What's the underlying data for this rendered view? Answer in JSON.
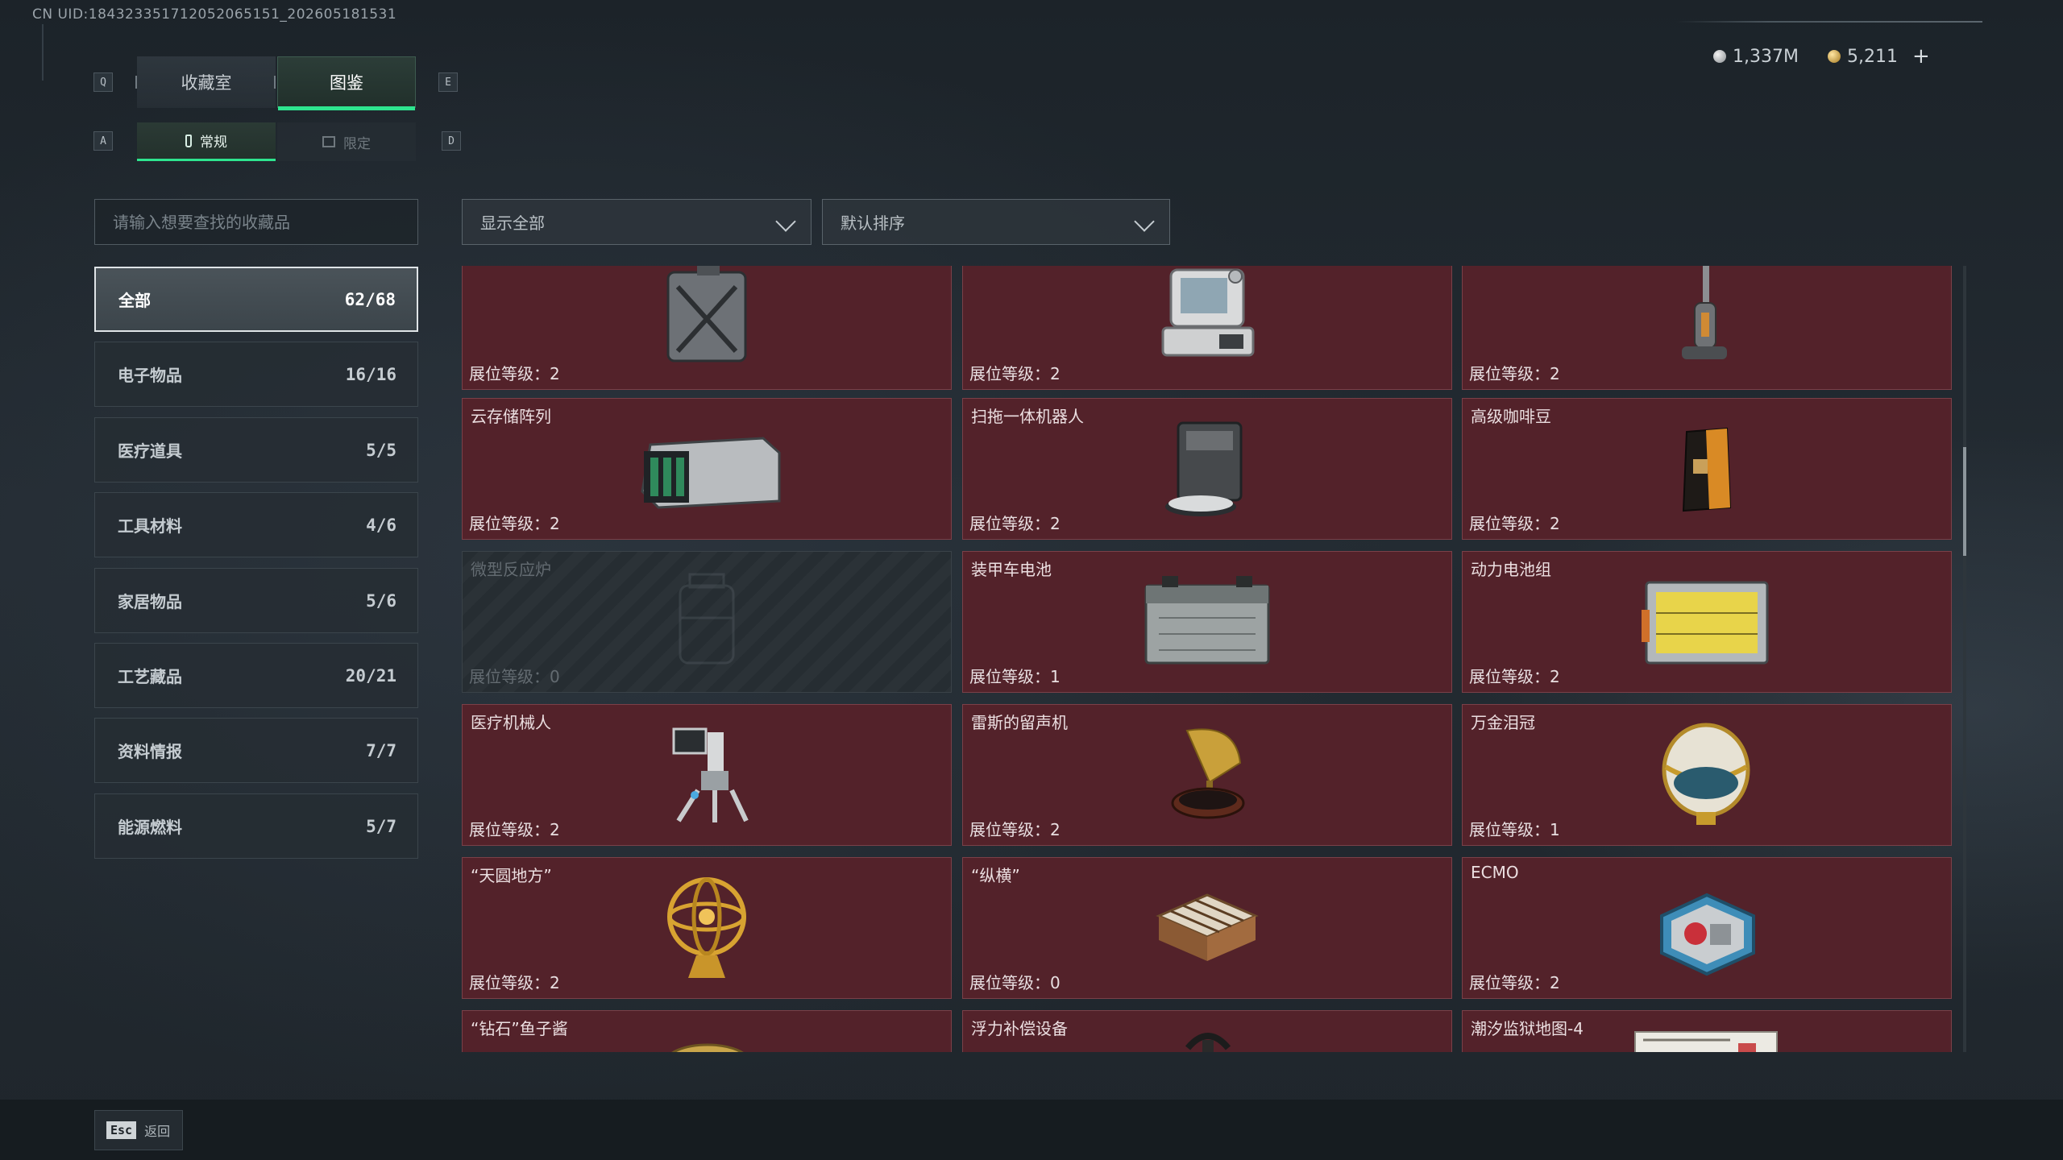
{
  "uid_text": "CN UID:184323351712052065151_202605181531",
  "top_tabs": {
    "left_key": "Q",
    "right_key": "E",
    "items": [
      {
        "label": "收藏室",
        "active": false
      },
      {
        "label": "图鉴",
        "active": true
      }
    ]
  },
  "sub_tabs": {
    "left_key": "A",
    "right_key": "D",
    "items": [
      {
        "label": "常规",
        "icon": "bottle-icon",
        "active": true
      },
      {
        "label": "限定",
        "icon": "image-icon",
        "active": false
      }
    ]
  },
  "currency": {
    "silver": {
      "value": "1,337M",
      "icon": "silver-coin-icon"
    },
    "gold": {
      "value": "5,211",
      "icon": "gold-coin-icon",
      "add_label": "+"
    }
  },
  "search": {
    "placeholder": "请输入想要查找的收藏品",
    "value": ""
  },
  "filters": {
    "display": "显示全部",
    "sort": "默认排序"
  },
  "categories": [
    {
      "label": "全部",
      "count": "62/68",
      "active": true
    },
    {
      "label": "电子物品",
      "count": "16/16",
      "active": false
    },
    {
      "label": "医疗道具",
      "count": "5/5",
      "active": false
    },
    {
      "label": "工具材料",
      "count": "4/6",
      "active": false
    },
    {
      "label": "家居物品",
      "count": "5/6",
      "active": false
    },
    {
      "label": "工艺藏品",
      "count": "20/21",
      "active": false
    },
    {
      "label": "资料情报",
      "count": "7/7",
      "active": false
    },
    {
      "label": "能源燃料",
      "count": "5/7",
      "active": false
    }
  ],
  "level_prefix": "展位等级：",
  "items": [
    {
      "name": "",
      "level": "2",
      "icon": "jerrycan-icon",
      "locked": false
    },
    {
      "name": "",
      "level": "2",
      "icon": "retro-computer-icon",
      "locked": false
    },
    {
      "name": "",
      "level": "2",
      "icon": "floor-washer-icon",
      "locked": false
    },
    {
      "name": "云存储阵列",
      "level": "2",
      "icon": "server-array-icon",
      "locked": false
    },
    {
      "name": "扫拖一体机器人",
      "level": "2",
      "icon": "robot-vacuum-icon",
      "locked": false
    },
    {
      "name": "高级咖啡豆",
      "level": "2",
      "icon": "coffee-bag-icon",
      "locked": false
    },
    {
      "name": "微型反应炉",
      "level": "0",
      "icon": "reactor-icon",
      "locked": true
    },
    {
      "name": "装甲车电池",
      "level": "1",
      "icon": "car-battery-icon",
      "locked": false
    },
    {
      "name": "动力电池组",
      "level": "2",
      "icon": "battery-pack-icon",
      "locked": false
    },
    {
      "name": "医疗机械人",
      "level": "2",
      "icon": "medical-robot-icon",
      "locked": false
    },
    {
      "name": "雷斯的留声机",
      "level": "2",
      "icon": "gramophone-icon",
      "locked": false
    },
    {
      "name": "万金泪冠",
      "level": "1",
      "icon": "jeweled-egg-icon",
      "locked": false
    },
    {
      "name": "“天圆地方”",
      "level": "2",
      "icon": "armillary-sphere-icon",
      "locked": false
    },
    {
      "name": "“纵横”",
      "level": "0",
      "icon": "chess-box-icon",
      "locked": false
    },
    {
      "name": "ECMO",
      "level": "2",
      "icon": "ecmo-icon",
      "locked": false
    },
    {
      "name": "“钻石”鱼子酱",
      "level": "",
      "icon": "caviar-tin-icon",
      "locked": false
    },
    {
      "name": "浮力补偿设备",
      "level": "",
      "icon": "bcd-icon",
      "locked": false
    },
    {
      "name": "潮汐监狱地图-4",
      "level": "",
      "icon": "map-document-icon",
      "locked": false
    }
  ],
  "bottom": {
    "esc_key": "Esc",
    "back_label": "返回"
  },
  "colors": {
    "accent": "#2ee58f",
    "card_bg": "#53222a",
    "card_border": "#7a4048"
  }
}
